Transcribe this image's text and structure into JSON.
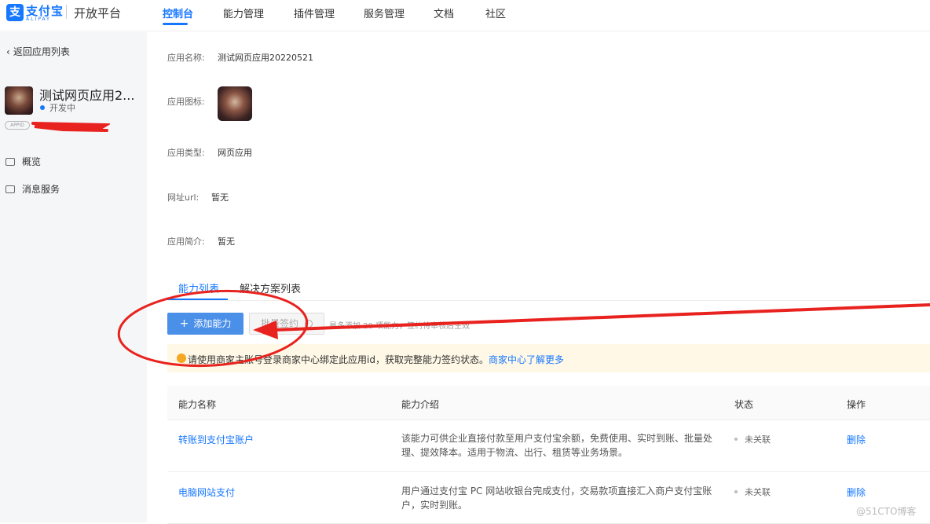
{
  "header": {
    "logo_text": "支付宝",
    "logo_sub": "ALIPAY",
    "platform_title": "开放平台",
    "nav": [
      "控制台",
      "能力管理",
      "插件管理",
      "服务管理",
      "文档",
      "社区"
    ],
    "active_nav": "控制台"
  },
  "sidebar": {
    "back_label": "返回应用列表",
    "app_name": "测试网页应用2...",
    "app_status": "开发中",
    "appid_badge": "APPID",
    "items": [
      "概览",
      "消息服务"
    ]
  },
  "details": {
    "name_label": "应用名称:",
    "name_value": "测试网页应用20220521",
    "icon_label": "应用图标:",
    "type_label": "应用类型:",
    "type_value": "网页应用",
    "url_label": "网址url:",
    "url_value": "暂无",
    "intro_label": "应用简介:",
    "intro_value": "暂无"
  },
  "tabs": [
    "能力列表",
    "解决方案列表"
  ],
  "toolbar": {
    "add_label": "添加能力",
    "batch_label": "批量签约",
    "hint": "最多添加 20 项能力，签约待审核后生效"
  },
  "notice": {
    "text": "请使用商家主账号登录商家中心绑定此应用id，获取完整能力签约状态。",
    "link": "商家中心了解更多"
  },
  "table": {
    "headers": [
      "能力名称",
      "能力介绍",
      "状态",
      "操作"
    ],
    "rows": [
      {
        "name": "转账到支付宝账户",
        "desc": "该能力可供企业直接付款至用户支付宝余额，免费使用、实时到账、批量处理、提效降本。适用于物流、出行、租赁等业务场景。",
        "status": "未关联",
        "action": "删除"
      },
      {
        "name": "电脑网站支付",
        "desc": "用户通过支付宝 PC 网站收银台完成支付，交易款项直接汇入商户支付宝账户，实时到账。",
        "status": "未关联",
        "action": "删除"
      }
    ]
  },
  "watermark": "@51CTO博客",
  "colors": {
    "accent": "#1677ff",
    "annotation": "#e8231f"
  }
}
